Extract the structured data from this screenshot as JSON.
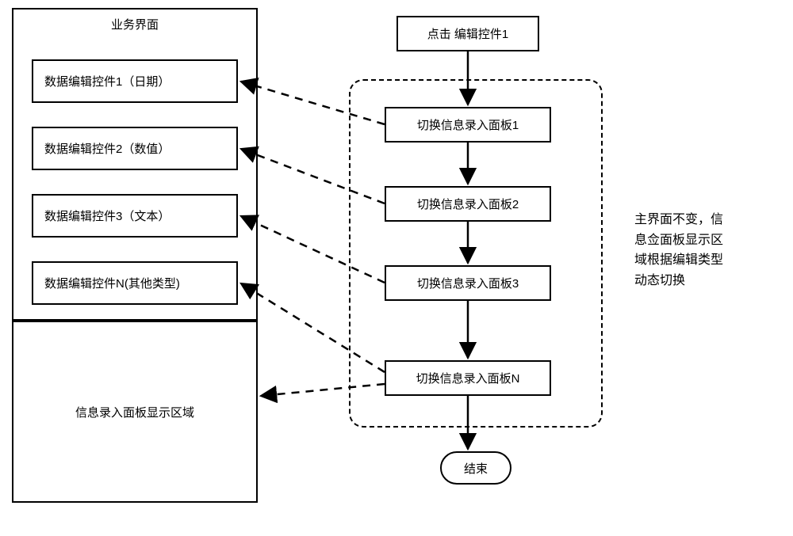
{
  "left_panel": {
    "title": "业务界面",
    "controls": [
      "数据编辑控件1（日期）",
      "数据编辑控件2（数值）",
      "数据编辑控件3（文本）",
      "数据编辑控件N(其他类型)"
    ],
    "display_area": "信息录入面板显示区域"
  },
  "flow": {
    "start": "点击 编辑控件1",
    "steps": [
      "切换信息录入面板1",
      "切换信息录入面板2",
      "切换信息录入面板3",
      "切换信息录入面板N"
    ],
    "end": "结束"
  },
  "annotation": {
    "line1": "主界面不变，信",
    "line2": "息佥面板显示区",
    "line3": "域根据编辑类型",
    "line4": "动态切换"
  },
  "chart_data": {
    "type": "table",
    "description": "UI flow diagram: left = business interface with four data-editing controls and an info-entry panel display area; right = flowchart from '点击 编辑控件1' through four '切换信息录入面板' steps to '结束', enclosed in a dashed region annotated that the main interface stays constant while the info-entry panel area switches dynamically based on edit type.",
    "left_interface_elements": [
      "数据编辑控件1（日期）",
      "数据编辑控件2（数值）",
      "数据编辑控件3（文本）",
      "数据编辑控件N(其他类型)",
      "信息录入面板显示区域"
    ],
    "flow_sequence": [
      "点击 编辑控件1",
      "切换信息录入面板1",
      "切换信息录入面板2",
      "切换信息录入面板3",
      "切换信息录入面板N",
      "结束"
    ],
    "dashed_edges": [
      [
        "切换信息录入面板1",
        "数据编辑控件1（日期）"
      ],
      [
        "切换信息录入面板2",
        "数据编辑控件2（数值）"
      ],
      [
        "切换信息录入面板3",
        "数据编辑控件3（文本）"
      ],
      [
        "切换信息录入面板N",
        "数据编辑控件N(其他类型)"
      ],
      [
        "切换信息录入面板N",
        "信息录入面板显示区域"
      ]
    ]
  }
}
